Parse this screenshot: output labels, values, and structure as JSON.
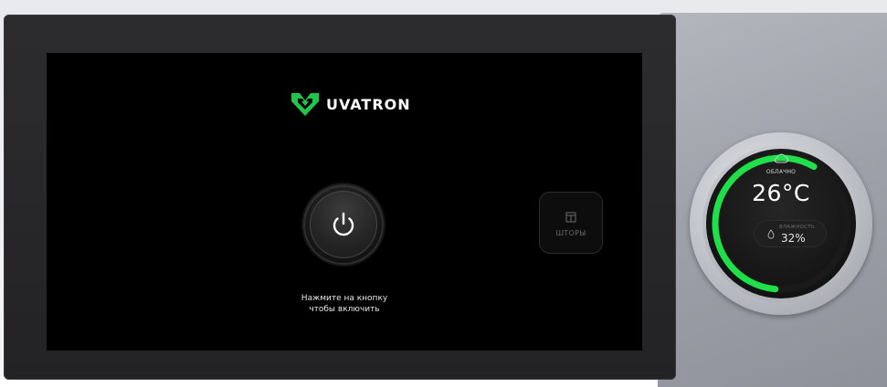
{
  "brand": {
    "name": "UVATRON",
    "accent": "#22c54a"
  },
  "main": {
    "power_icon": "power-icon",
    "hint_line1": "Нажмите на кнопку",
    "hint_line2": "чтобы включить",
    "curtains": {
      "icon": "curtains-icon",
      "label": "ШТОРЫ"
    }
  },
  "thermostat": {
    "weather_icon": "cloud-icon",
    "weather": "ОБЛАЧНО",
    "temperature": "26°C",
    "humidity_icon": "drop-icon",
    "humidity_label": "ВЛАЖНОСТЬ",
    "humidity_value": "32%",
    "ring_color": "#1fe04a"
  },
  "colors": {
    "screen": "#000000",
    "bezel": "#2a2a2c",
    "panel": "#a3a6ad"
  }
}
